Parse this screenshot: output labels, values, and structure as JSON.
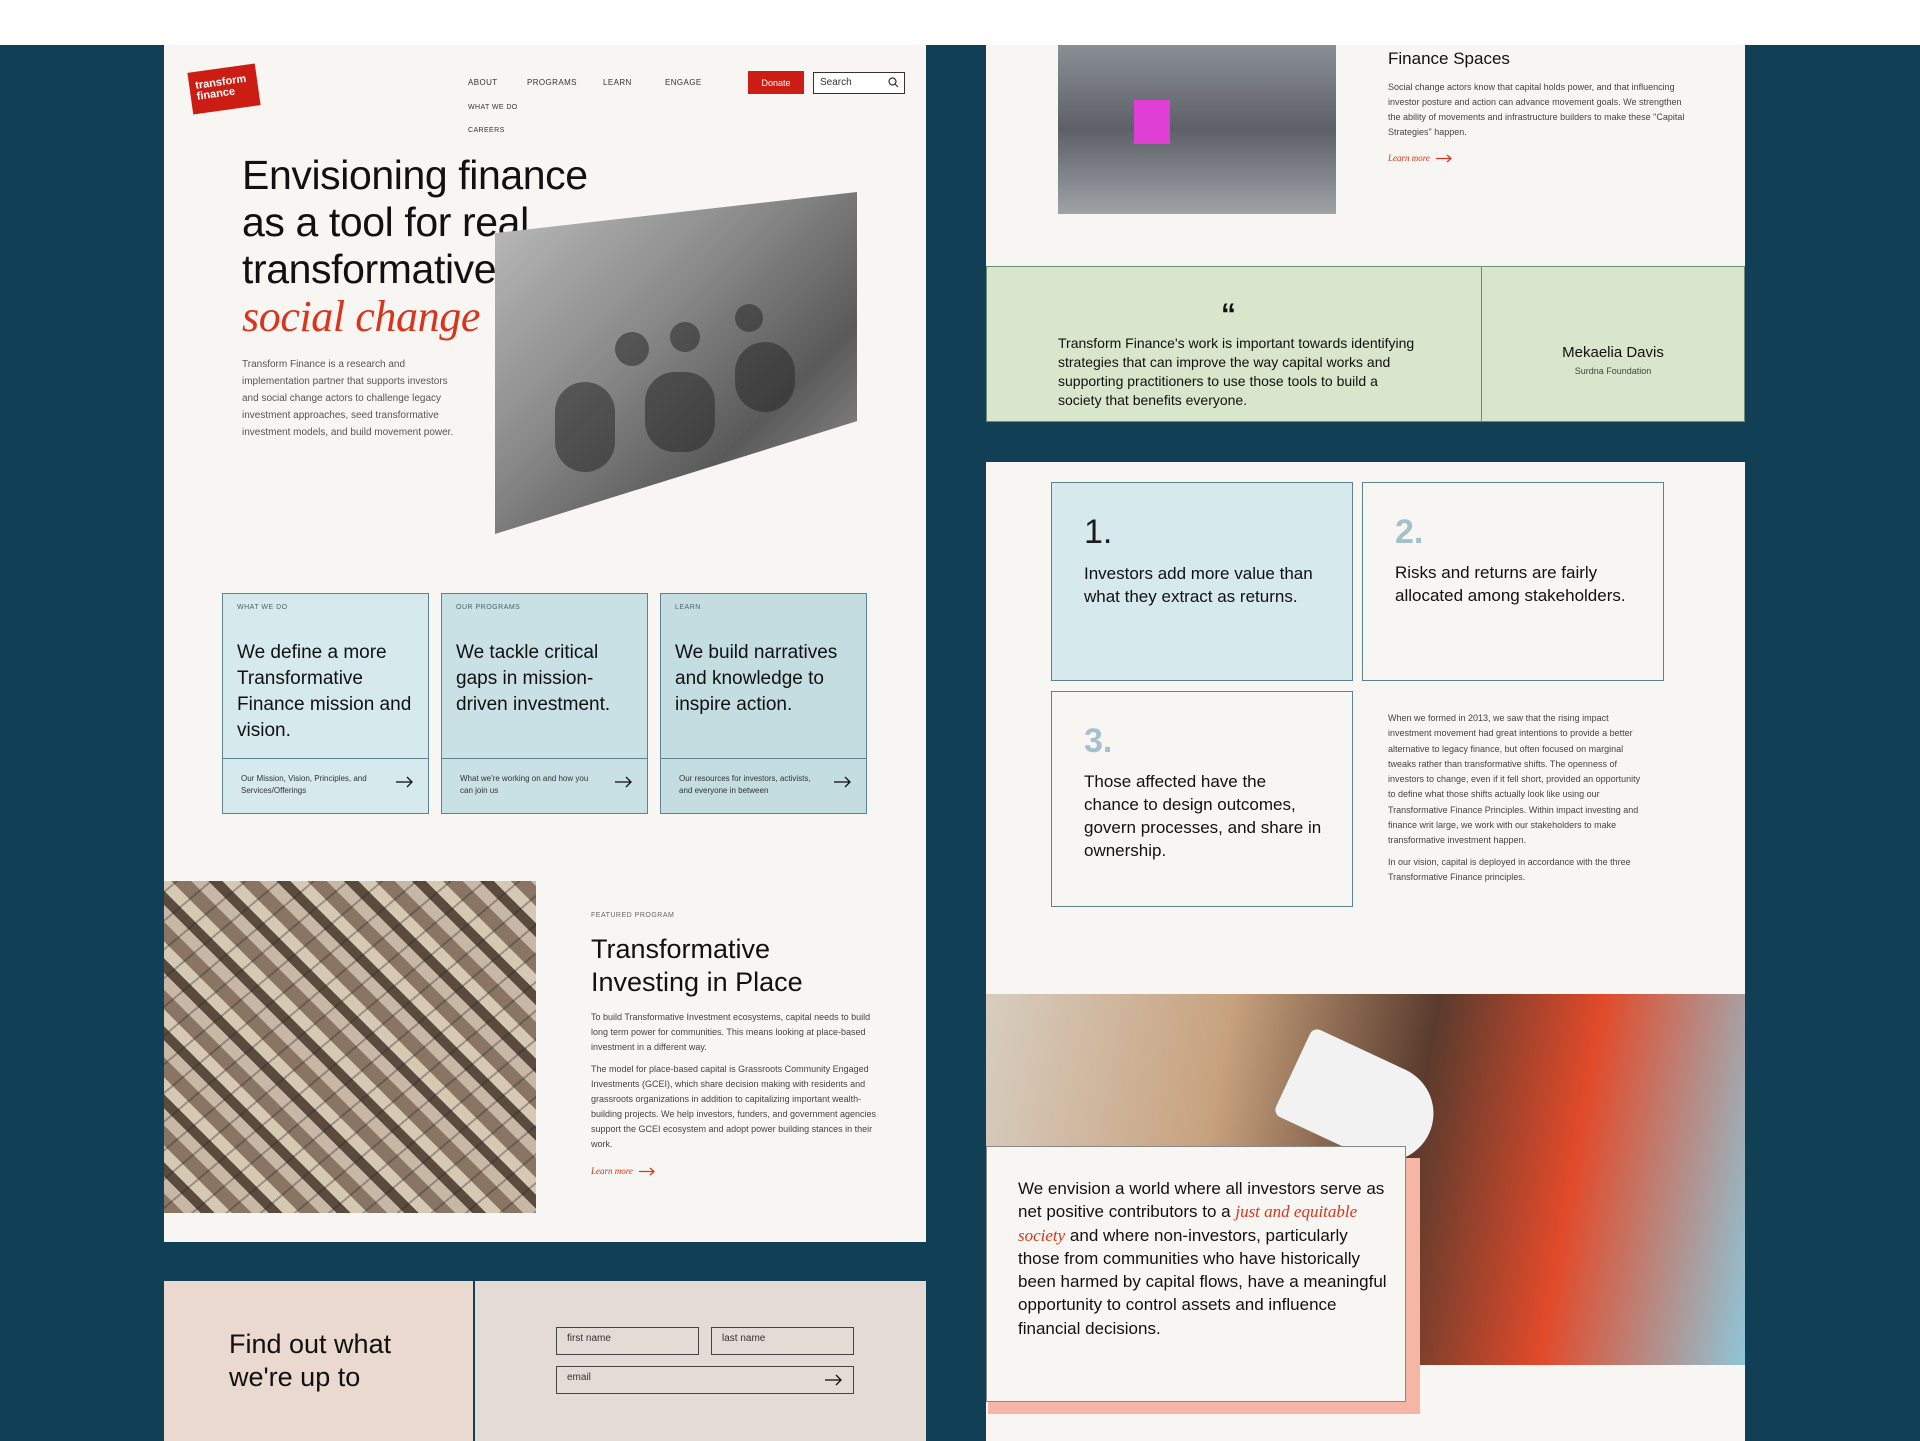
{
  "brand": {
    "logo_text": "transform finance",
    "accent": "#cc1d15",
    "navy": "#113f55"
  },
  "nav": {
    "items": [
      "ABOUT",
      "PROGRAMS",
      "LEARN",
      "ENGAGE"
    ],
    "sub_items": [
      "WHAT WE DO",
      "CAREERS"
    ],
    "donate_label": "Donate",
    "search_placeholder": "Search"
  },
  "hero": {
    "title_line1": "Envisioning finance",
    "title_line2": "as a tool for real,",
    "title_line3": "transformative",
    "title_accent": "social change",
    "description": "Transform Finance is a research and implementation partner that supports investors and social change actors to challenge legacy investment approaches, seed transformative investment models, and build movement power."
  },
  "cards": [
    {
      "tag": "WHAT WE DO",
      "title": "We define a more Transformative Finance mission and vision.",
      "link": "Our Mission, Vision, Principles, and Services/Offerings",
      "color": "#d6e9ec"
    },
    {
      "tag": "OUR PROGRAMS",
      "title": "We tackle critical gaps in mission-driven investment.",
      "link": "What we're working on and how you can join us",
      "color": "#c9e0e4"
    },
    {
      "tag": "LEARN",
      "title": "We build narratives and knowledge to inspire action.",
      "link": "Our resources for investors, activists, and everyone in between",
      "color": "#c3dde1"
    }
  ],
  "featured": {
    "tag": "FEATURED PROGRAM",
    "title_line1": "Transformative",
    "title_line2": "Investing in Place",
    "para1": "To build Transformative Investment ecosystems, capital needs to build long term power for communities. This means looking at place-based investment in a different way.",
    "para2": "The model for place-based capital is Grassroots Community Engaged Investments (GCEI), which share decision making with residents and grassroots organizations in addition to capitalizing important wealth-building projects. We help investors, funders, and government agencies support the GCEI ecosystem and adopt power building stances in their work.",
    "learn_more": "Learn more"
  },
  "newsletter": {
    "title_line1": "Find out what",
    "title_line2": "we're up to",
    "first_name": "first name",
    "last_name": "last name",
    "email": "email"
  },
  "finance_spaces": {
    "title": "Finance Spaces",
    "body": "Social change actors know that capital holds power, and that influencing investor posture and action can advance movement goals. We strengthen the ability of movements and infrastructure builders to make these \"Capital Strategies\" happen.",
    "learn_more": "Learn more"
  },
  "quote": {
    "mark": "“",
    "text": "Transform Finance's work is important towards identifying strategies that can improve the way capital works and supporting practitioners to use those tools to build a society that benefits everyone.",
    "name": "Mekaelia Davis",
    "org": "Surdna Foundation"
  },
  "principles": [
    {
      "num": "1.",
      "text": "Investors add more value than what they extract as returns."
    },
    {
      "num": "2.",
      "text": "Risks and returns are fairly allocated among stakeholders."
    },
    {
      "num": "3.",
      "text": "Those affected have the chance to design outcomes, govern processes, and share in ownership."
    }
  ],
  "principles_body": {
    "para1": "When we formed in 2013, we saw that the rising impact investment movement had great intentions to provide a better alternative to legacy finance, but often focused on marginal tweaks rather than transformative shifts. The openness of investors to change, even if it fell short, provided an opportunity to define what those shifts actually look like using our Transformative Finance Principles. Within impact investing and finance writ large, we work with our stakeholders to make transformative investment happen.",
    "para2": "In our vision, capital is deployed in accordance with the three Transformative Finance principles."
  },
  "vision": {
    "before": "We envision a world where all investors serve as net positive contributors to a ",
    "accent": "just and equitable society",
    "after": " and where non-investors, particularly those from communities who have historically been harmed by capital flows, have a meaningful opportunity to control assets and influence financial decisions."
  }
}
